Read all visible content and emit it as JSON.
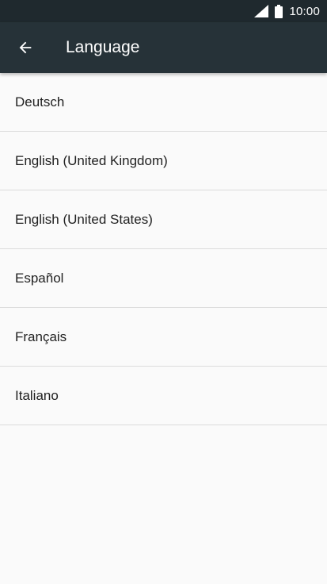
{
  "status_bar": {
    "time": "10:00",
    "signal_icon": "cell-signal-icon",
    "battery_icon": "battery-icon"
  },
  "app_bar": {
    "back_icon": "arrow-back-icon",
    "title": "Language",
    "background": "#263238"
  },
  "languages": [
    {
      "label": "Deutsch"
    },
    {
      "label": "English (United Kingdom)"
    },
    {
      "label": "English (United States)"
    },
    {
      "label": "Español"
    },
    {
      "label": "Français"
    },
    {
      "label": "Italiano"
    }
  ]
}
